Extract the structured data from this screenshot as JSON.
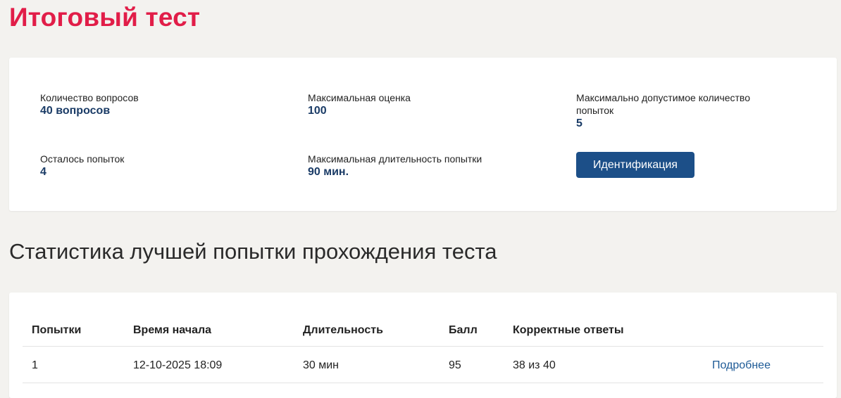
{
  "page": {
    "title": "Итоговый тест"
  },
  "info": {
    "questions_label": "Количество вопросов",
    "questions_value": "40 вопросов",
    "max_score_label": "Максимальная оценка",
    "max_score_value": "100",
    "max_attempts_label": "Максимально допустимое количество попыток",
    "max_attempts_value": "5",
    "remaining_label": "Осталось попыток",
    "remaining_value": "4",
    "max_duration_label": "Максимальная длительность попытки",
    "max_duration_value": "90 мин.",
    "id_button_label": "Идентификация"
  },
  "stats": {
    "title": "Статистика лучшей попытки прохождения теста",
    "columns": {
      "attempts": "Попытки",
      "start_time": "Время начала",
      "duration": "Длительность",
      "score": "Балл",
      "correct": "Корректные ответы"
    },
    "rows": [
      {
        "attempt": "1",
        "start_time": "12-10-2025 18:09",
        "duration": "30 мин",
        "score": "95",
        "correct": "38 из 40",
        "details": "Подробнее"
      }
    ]
  },
  "colors": {
    "title_red": "#e11d48",
    "value_blue": "#1a3b66",
    "button_blue": "#1c4f88",
    "link_blue": "#1d5a96",
    "background": "#f3f2ef"
  }
}
